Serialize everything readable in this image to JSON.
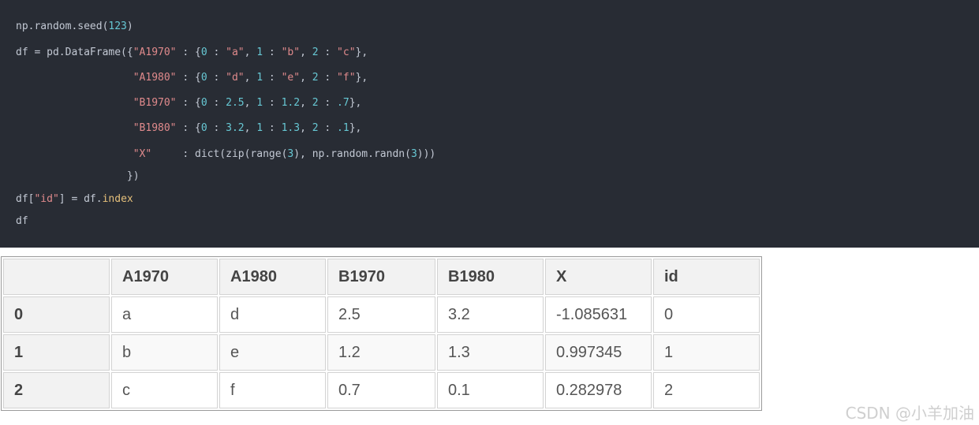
{
  "code_lines": [
    [
      [
        "np.random.seed(",
        "plain"
      ],
      [
        "123",
        "num"
      ],
      [
        ")",
        "plain"
      ]
    ],
    [
      [
        "df = pd.DataFrame({",
        "plain"
      ],
      [
        "\"A1970\"",
        "str"
      ],
      [
        " : {",
        "plain"
      ],
      [
        "0",
        "num"
      ],
      [
        " : ",
        "plain"
      ],
      [
        "\"a\"",
        "str"
      ],
      [
        ", ",
        "plain"
      ],
      [
        "1",
        "num"
      ],
      [
        " : ",
        "plain"
      ],
      [
        "\"b\"",
        "str"
      ],
      [
        ", ",
        "plain"
      ],
      [
        "2",
        "num"
      ],
      [
        " : ",
        "plain"
      ],
      [
        "\"c\"",
        "str"
      ],
      [
        "},",
        "plain"
      ]
    ],
    [
      [
        "                   ",
        "plain"
      ],
      [
        "\"A1980\"",
        "str"
      ],
      [
        " : {",
        "plain"
      ],
      [
        "0",
        "num"
      ],
      [
        " : ",
        "plain"
      ],
      [
        "\"d\"",
        "str"
      ],
      [
        ", ",
        "plain"
      ],
      [
        "1",
        "num"
      ],
      [
        " : ",
        "plain"
      ],
      [
        "\"e\"",
        "str"
      ],
      [
        ", ",
        "plain"
      ],
      [
        "2",
        "num"
      ],
      [
        " : ",
        "plain"
      ],
      [
        "\"f\"",
        "str"
      ],
      [
        "},",
        "plain"
      ]
    ],
    [
      [
        "                   ",
        "plain"
      ],
      [
        "\"B1970\"",
        "str"
      ],
      [
        " : {",
        "plain"
      ],
      [
        "0",
        "num"
      ],
      [
        " : ",
        "plain"
      ],
      [
        "2.5",
        "num"
      ],
      [
        ", ",
        "plain"
      ],
      [
        "1",
        "num"
      ],
      [
        " : ",
        "plain"
      ],
      [
        "1.2",
        "num"
      ],
      [
        ", ",
        "plain"
      ],
      [
        "2",
        "num"
      ],
      [
        " : ",
        "plain"
      ],
      [
        ".7",
        "num"
      ],
      [
        "},",
        "plain"
      ]
    ],
    [
      [
        "                   ",
        "plain"
      ],
      [
        "\"B1980\"",
        "str"
      ],
      [
        " : {",
        "plain"
      ],
      [
        "0",
        "num"
      ],
      [
        " : ",
        "plain"
      ],
      [
        "3.2",
        "num"
      ],
      [
        ", ",
        "plain"
      ],
      [
        "1",
        "num"
      ],
      [
        " : ",
        "plain"
      ],
      [
        "1.3",
        "num"
      ],
      [
        ", ",
        "plain"
      ],
      [
        "2",
        "num"
      ],
      [
        " : ",
        "plain"
      ],
      [
        ".1",
        "num"
      ],
      [
        "},",
        "plain"
      ]
    ],
    [
      [
        "                   ",
        "plain"
      ],
      [
        "\"X\"",
        "str"
      ],
      [
        "     : dict(zip(range(",
        "plain"
      ],
      [
        "3",
        "num"
      ],
      [
        "), np.random.randn(",
        "plain"
      ],
      [
        "3",
        "num"
      ],
      [
        ")))",
        "plain"
      ]
    ],
    [
      [
        "                  })",
        "plain"
      ]
    ],
    [
      [
        "df[",
        "plain"
      ],
      [
        "\"id\"",
        "str"
      ],
      [
        "] = df.",
        "plain"
      ],
      [
        "index",
        "attr"
      ]
    ],
    [
      [
        "df",
        "plain"
      ]
    ]
  ],
  "table": {
    "columns": [
      "",
      "A1970",
      "A1980",
      "B1970",
      "B1980",
      "X",
      "id"
    ],
    "rows": [
      [
        "0",
        "a",
        "d",
        "2.5",
        "3.2",
        "-1.085631",
        "0"
      ],
      [
        "1",
        "b",
        "e",
        "1.2",
        "1.3",
        "0.997345",
        "1"
      ],
      [
        "2",
        "c",
        "f",
        "0.7",
        "0.1",
        "0.282978",
        "2"
      ]
    ]
  },
  "watermark": "CSDN @小羊加油"
}
